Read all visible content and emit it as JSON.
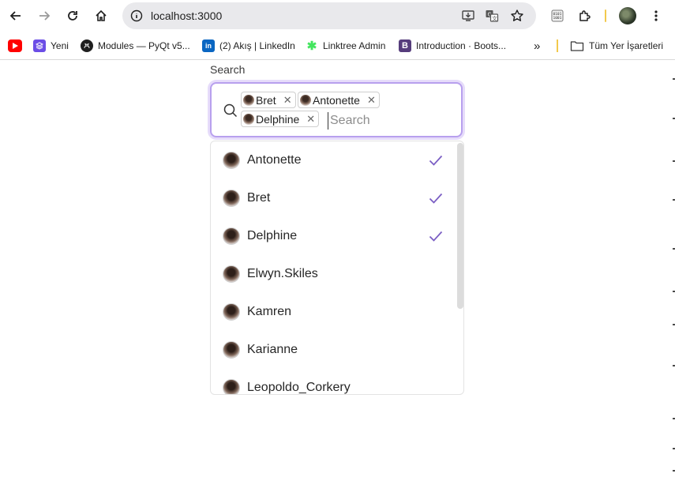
{
  "browser": {
    "url": "localhost:3000"
  },
  "bookmarks": [
    {
      "label": "",
      "icon": "youtube-icon"
    },
    {
      "label": "Yeni",
      "icon": "stack-icon"
    },
    {
      "label": "Modules — PyQt v5...",
      "icon": "github-icon"
    },
    {
      "label": "(2) Akış | LinkedIn",
      "icon": "linkedin-icon"
    },
    {
      "label": "Linktree Admin",
      "icon": "linktree-icon"
    },
    {
      "label": "Introduction · Boots...",
      "icon": "bootstrap-icon"
    }
  ],
  "bookmarks_more": "»",
  "all_bookmarks_label": "Tüm Yer İşaretleri",
  "search": {
    "label": "Search",
    "placeholder": "Search",
    "value": "",
    "selected": [
      "Bret",
      "Antonette",
      "Delphine"
    ]
  },
  "options": [
    {
      "name": "Antonette",
      "selected": true
    },
    {
      "name": "Bret",
      "selected": true
    },
    {
      "name": "Delphine",
      "selected": true
    },
    {
      "name": "Elwyn.Skiles",
      "selected": false
    },
    {
      "name": "Kamren",
      "selected": false
    },
    {
      "name": "Karianne",
      "selected": false
    },
    {
      "name": "Leopoldo_Corkery",
      "selected": false
    }
  ],
  "colors": {
    "accent": "#7b5fc4",
    "focus_ring": "#b8a0ee"
  }
}
